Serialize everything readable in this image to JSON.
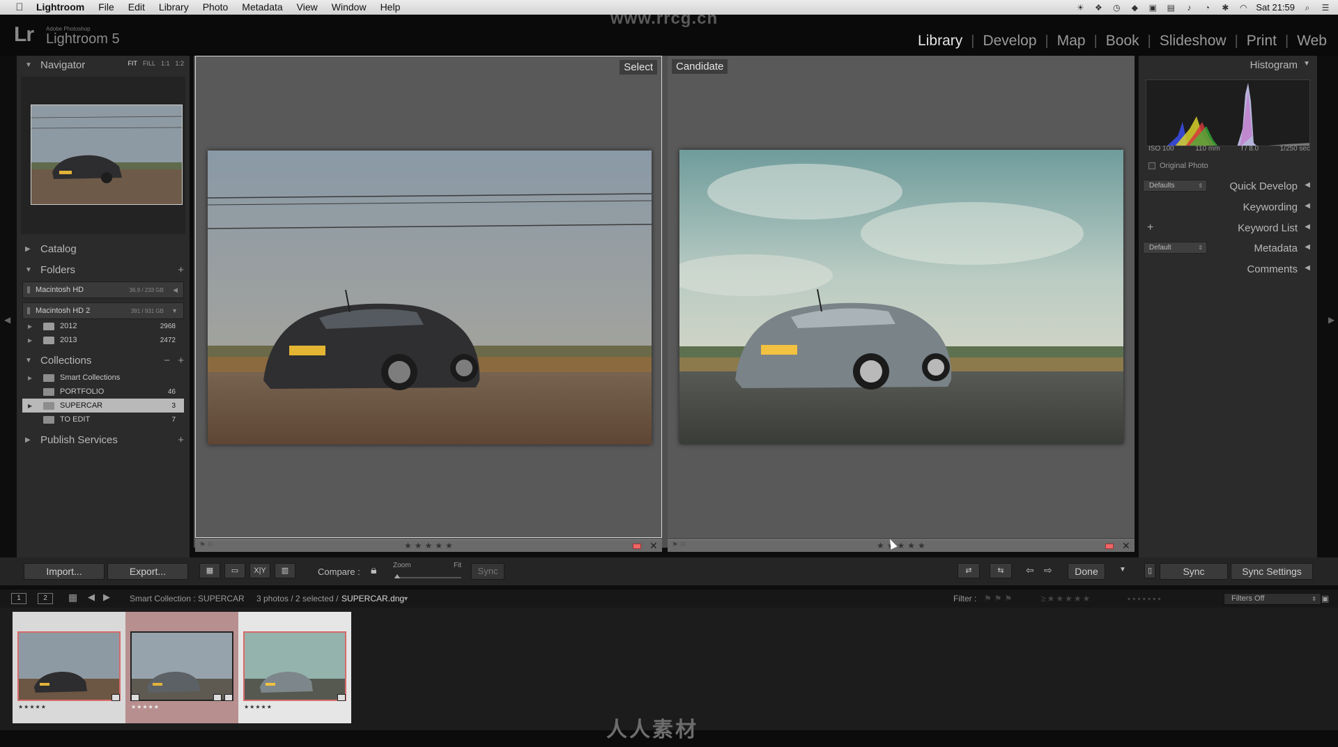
{
  "menubar": {
    "app": "Lightroom",
    "items": [
      "File",
      "Edit",
      "Library",
      "Photo",
      "Metadata",
      "View",
      "Window",
      "Help"
    ],
    "clock": "Sat 21:59"
  },
  "identity": {
    "logo": "Lr",
    "sub": "Adobe Photoshop",
    "name": "Lightroom 5",
    "watermark": "www.rrcg.cn"
  },
  "modules": [
    "Library",
    "Develop",
    "Map",
    "Book",
    "Slideshow",
    "Print",
    "Web"
  ],
  "left": {
    "navigator": {
      "title": "Navigator",
      "opts": [
        "FIT",
        "FILL",
        "1:1",
        "1:2"
      ]
    },
    "catalog": "Catalog",
    "folders": {
      "title": "Folders",
      "volumes": [
        {
          "name": "Macintosh HD",
          "size": "36.9 / 233 GB"
        },
        {
          "name": "Macintosh HD 2",
          "size": "391 / 931 GB"
        }
      ],
      "items": [
        {
          "name": "2012",
          "count": "2968"
        },
        {
          "name": "2013",
          "count": "2472"
        }
      ]
    },
    "collections": {
      "title": "Collections",
      "items": [
        {
          "name": "Smart Collections",
          "count": ""
        },
        {
          "name": "PORTFOLIO",
          "count": "46"
        },
        {
          "name": "SUPERCAR",
          "count": "3"
        },
        {
          "name": "TO EDIT",
          "count": "7"
        }
      ]
    },
    "publish": "Publish Services",
    "import_label": "Import...",
    "export_label": "Export..."
  },
  "right": {
    "histogram": "Histogram",
    "info": [
      "ISO 100",
      "110 mm",
      "f / 8.0",
      "1/250 sec"
    ],
    "original_photo": "Original Photo",
    "quick_develop": "Quick Develop",
    "qd_preset": "Defaults",
    "keywording": "Keywording",
    "keyword_list": "Keyword List",
    "metadata": "Metadata",
    "metadata_preset": "Default",
    "comments": "Comments",
    "sync_label": "Sync",
    "sync_settings_label": "Sync Settings"
  },
  "compare": {
    "select_label": "Select",
    "candidate_label": "Candidate",
    "stars": "★★★★★"
  },
  "toolbar": {
    "compare_label": "Compare :",
    "zoom_label": "Zoom",
    "fit_label": "Fit",
    "sync_label": "Sync",
    "done_label": "Done",
    "view_xy": "X|Y"
  },
  "filmstrip": {
    "screens": [
      "1",
      "2"
    ],
    "source": "Smart Collection : SUPERCAR",
    "count": "3 photos / 2 selected /",
    "filename": "SUPERCAR.dng",
    "filter_label": "Filter :",
    "filters_off": "Filters Off",
    "stars": "★★★★★"
  },
  "bottom_brand": "人人素材",
  "colors": {
    "label_red": "#e66666",
    "selected_row": "#b9b9b9",
    "accent": "#d86a6a"
  }
}
